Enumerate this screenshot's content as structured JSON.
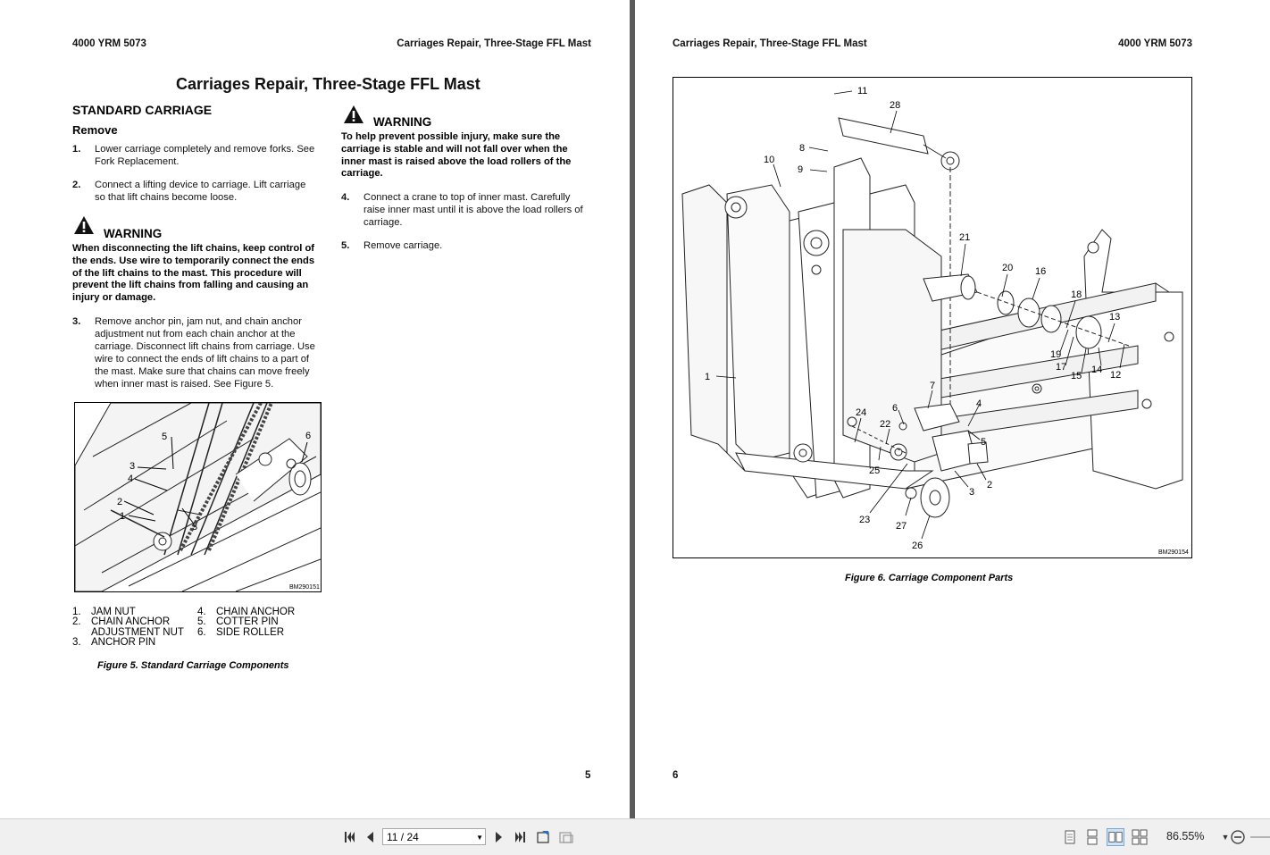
{
  "left_page": {
    "header_left": "4000 YRM 5073",
    "header_right": "Carriages Repair, Three-Stage FFL Mast",
    "title": "Carriages Repair, Three-Stage FFL Mast",
    "section": "STANDARD CARRIAGE",
    "subsection": "Remove",
    "steps": [
      {
        "num": "1.",
        "lines": [
          "Lower carriage completely and remove forks. See",
          "Fork Replacement."
        ]
      },
      {
        "num": "2.",
        "lines": [
          "Connect a lifting device to carriage. Lift carriage",
          "so that lift chains become loose."
        ]
      },
      {
        "num": "3.",
        "lines": [
          "Remove anchor pin, jam nut, and chain anchor",
          "adjustment nut from each chain anchor at the",
          "carriage. Disconnect lift chains from carriage. Use",
          "wire to connect the ends of lift chains to a part of",
          "the mast. Make sure that chains can move freely",
          "when inner mast is raised. See Figure 5."
        ]
      },
      {
        "num": "4.",
        "lines": [
          "Connect a crane to top of inner mast. Carefully",
          "raise inner mast until it is above the load rollers of",
          "carriage."
        ]
      },
      {
        "num": "5.",
        "lines": [
          "Remove carriage."
        ]
      }
    ],
    "warning1": {
      "label": "WARNING",
      "lines": [
        "When disconnecting the lift chains, keep control of",
        "the ends. Use wire to temporarily connect the ends",
        "of the lift chains to the mast. This procedure will",
        "prevent the lift chains from falling and causing an",
        "injury or damage."
      ]
    },
    "warning2": {
      "label": "WARNING",
      "lines": [
        "To help prevent possible injury, make sure the",
        "carriage is stable and will not fall over when the",
        "inner mast is raised above the load rollers of the",
        "carriage."
      ]
    },
    "figure": {
      "code": "BM290151",
      "callouts": [
        "1",
        "2",
        "3",
        "4",
        "5",
        "3",
        "6"
      ],
      "legend": [
        {
          "n": "1.",
          "t": "JAM NUT"
        },
        {
          "n": "2.",
          "t": "CHAIN ANCHOR"
        },
        {
          "n": "",
          "t": "ADJUSTMENT NUT"
        },
        {
          "n": "3.",
          "t": "ANCHOR PIN"
        },
        {
          "n": "4.",
          "t": "CHAIN ANCHOR"
        },
        {
          "n": "5.",
          "t": "COTTER PIN"
        },
        {
          "n": "6.",
          "t": "SIDE ROLLER"
        }
      ],
      "caption": "Figure 5. Standard Carriage Components"
    },
    "page_number": "5"
  },
  "right_page": {
    "header_left": "Carriages Repair, Three-Stage FFL Mast",
    "header_right": "4000 YRM 5073",
    "figure": {
      "code": "BM290154",
      "callouts": [
        "11",
        "28",
        "8",
        "10",
        "9",
        "21",
        "20",
        "16",
        "18",
        "13",
        "19",
        "17",
        "14",
        "15",
        "12",
        "1",
        "7",
        "4",
        "24",
        "6",
        "22",
        "5",
        "25",
        "2",
        "3",
        "23",
        "27",
        "26"
      ],
      "caption": "Figure 6. Carriage Component Parts"
    },
    "page_number": "6"
  },
  "toolbar": {
    "page_field": "11 / 24",
    "zoom": "86.55%",
    "icons": [
      "first-page-icon",
      "prev-page-icon",
      "next-page-icon",
      "last-page-icon",
      "previous-view-icon",
      "next-view-icon",
      "single-page-icon",
      "continuous-icon",
      "facing-icon",
      "continuous-facing-icon",
      "zoom-out-icon"
    ]
  }
}
